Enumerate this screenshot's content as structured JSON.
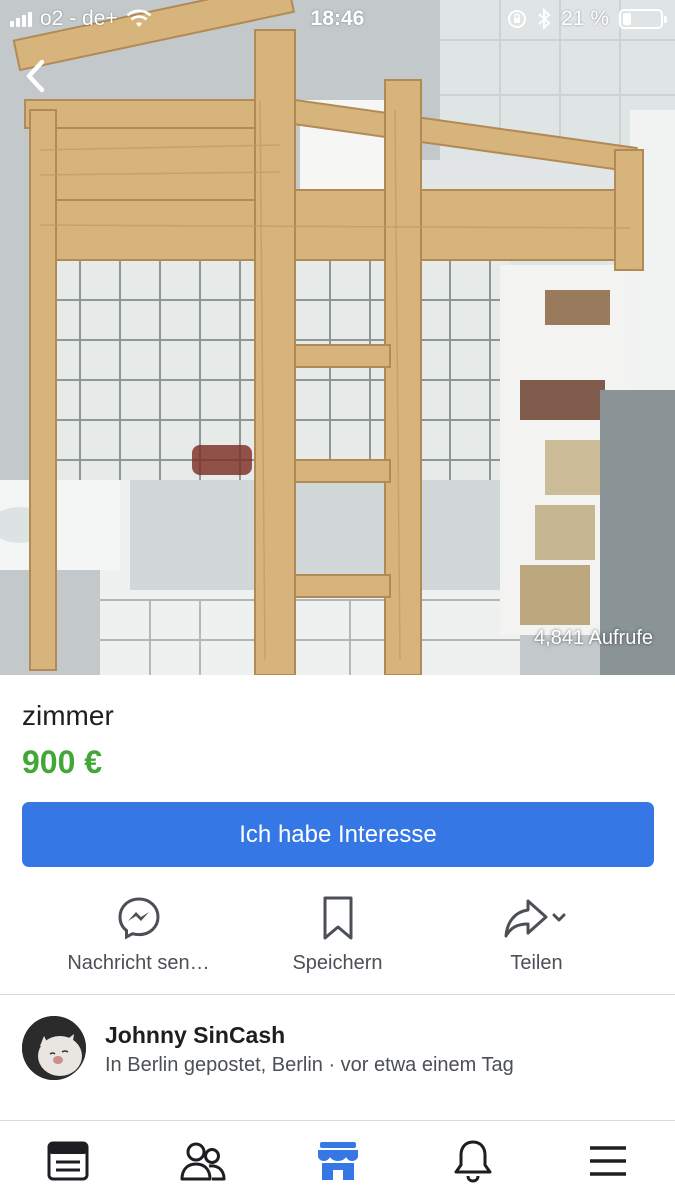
{
  "status_bar": {
    "carrier": "o2 - de+",
    "time": "18:46",
    "battery_percent": "21 %",
    "battery_level": 0.21
  },
  "listing": {
    "views": "4,841 Aufrufe",
    "title": "zimmer",
    "price": "900 €",
    "price_color": "#42a737",
    "interest_button": "Ich habe Interesse",
    "accent_color": "#3578e5"
  },
  "actions": {
    "message": {
      "label": "Nachricht sen…",
      "icon": "messenger-icon"
    },
    "save": {
      "label": "Speichern",
      "icon": "bookmark-icon"
    },
    "share": {
      "label": "Teilen",
      "icon": "share-icon"
    }
  },
  "seller": {
    "name": "Johnny SinCash",
    "meta": "In Berlin gepostet, Berlin · vor etwa einem Tag"
  },
  "tabbar": {
    "items": [
      {
        "name": "news-feed",
        "icon": "news-feed-icon",
        "active": false
      },
      {
        "name": "friends",
        "icon": "friends-icon",
        "active": false
      },
      {
        "name": "marketplace",
        "icon": "marketplace-icon",
        "active": true
      },
      {
        "name": "notifications",
        "icon": "bell-icon",
        "active": false
      },
      {
        "name": "menu",
        "icon": "menu-icon",
        "active": false
      }
    ]
  }
}
